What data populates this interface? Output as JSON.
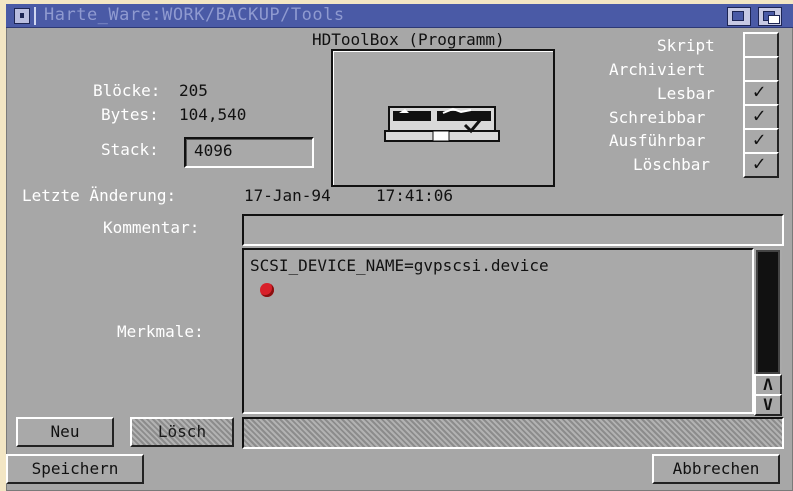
{
  "window": {
    "title": "Harte_Ware:WORK/BACKUP/Tools"
  },
  "heading": "HDToolBox (Programm)",
  "info": {
    "blocks_label": "Blöcke:",
    "blocks_value": "205",
    "bytes_label": "Bytes:",
    "bytes_value": "104,540",
    "stack_label": "Stack:",
    "stack_value": "4096",
    "changed_label": "Letzte Änderung:",
    "changed_date": "17-Jan-94",
    "changed_time": "17:41:06"
  },
  "flags": [
    {
      "label": "Skript",
      "checked": false
    },
    {
      "label": "Archiviert",
      "checked": false
    },
    {
      "label": "Lesbar",
      "checked": true
    },
    {
      "label": "Schreibbar",
      "checked": true
    },
    {
      "label": "Ausführbar",
      "checked": true
    },
    {
      "label": "Löschbar",
      "checked": true
    }
  ],
  "checkmark": "✓",
  "comment": {
    "label": "Kommentar:",
    "value": ""
  },
  "tooltypes": {
    "label": "Merkmale:",
    "entries": [
      "SCSI_DEVICE_NAME=gvpscsi.device"
    ],
    "scroll_up": "Λ",
    "scroll_down": "V"
  },
  "buttons": {
    "new": "Neu",
    "delete": "Lösch",
    "save": "Speichern",
    "cancel": "Abbrechen"
  }
}
